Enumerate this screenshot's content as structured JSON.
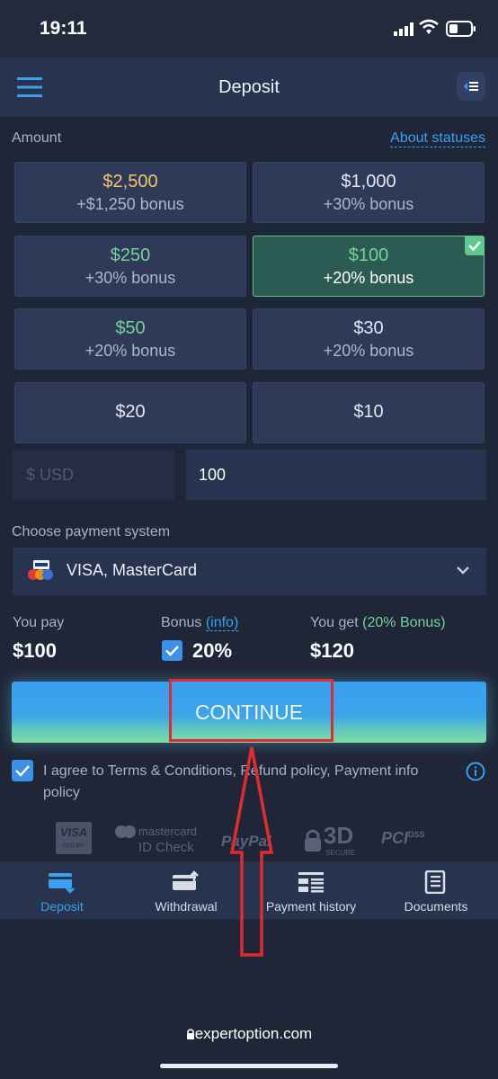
{
  "status_bar": {
    "time": "19:11"
  },
  "header": {
    "title": "Deposit"
  },
  "amount": {
    "label": "Amount",
    "about_link": "About statuses",
    "options": [
      {
        "value": "$2,500",
        "bonus": "+$1,250 bonus",
        "color": "#f3c869"
      },
      {
        "value": "$1,000",
        "bonus": "+30% bonus",
        "color": "#e3e8f2"
      },
      {
        "value": "$250",
        "bonus": "+30% bonus",
        "color": "#74d39b"
      },
      {
        "value": "$100",
        "bonus": "+20% bonus",
        "color": "#74d39b",
        "selected": true
      },
      {
        "value": "$50",
        "bonus": "+20% bonus",
        "color": "#74d39b"
      },
      {
        "value": "$30",
        "bonus": "+20% bonus",
        "color": "#e3e8f2"
      },
      {
        "value": "$20",
        "bonus": ""
      },
      {
        "value": "$10",
        "bonus": ""
      }
    ],
    "currency_placeholder": "$ USD",
    "input_value": "100"
  },
  "payment": {
    "label": "Choose payment system",
    "selected": "VISA, MasterCard",
    "icon": "card-brands-icon"
  },
  "summary": {
    "you_pay_label": "You pay",
    "you_pay": "$100",
    "bonus_label": "Bonus",
    "bonus_info": "(info)",
    "bonus_value": "20%",
    "bonus_checked": true,
    "you_get_label": "You get",
    "you_get_tag": "(20% Bonus)",
    "you_get": "$120"
  },
  "continue_label": "CONTINUE",
  "agreement": {
    "checked": true,
    "text": "I agree to Terms & Conditions, Refund policy, Payment info policy"
  },
  "trust_logos": {
    "visa": "VISA",
    "visa_sub": "SECURE",
    "mastercard_1": "mastercard",
    "mastercard_2": "ID Check",
    "paypal": "PayPal",
    "threed": "3D",
    "threed_sub": "SECURE",
    "pci": "PCI",
    "pci_sup": "DSS"
  },
  "bottom_nav": [
    {
      "label": "Deposit",
      "active": true
    },
    {
      "label": "Withdrawal"
    },
    {
      "label": "Payment history"
    },
    {
      "label": "Documents"
    }
  ],
  "browser": {
    "url": "expertoption.com"
  },
  "colors": {
    "accent": "#3aa0f0",
    "selected_tile": "#2c5b54",
    "highlight_red": "#e22b2f",
    "bonus_green": "#74d39b"
  }
}
